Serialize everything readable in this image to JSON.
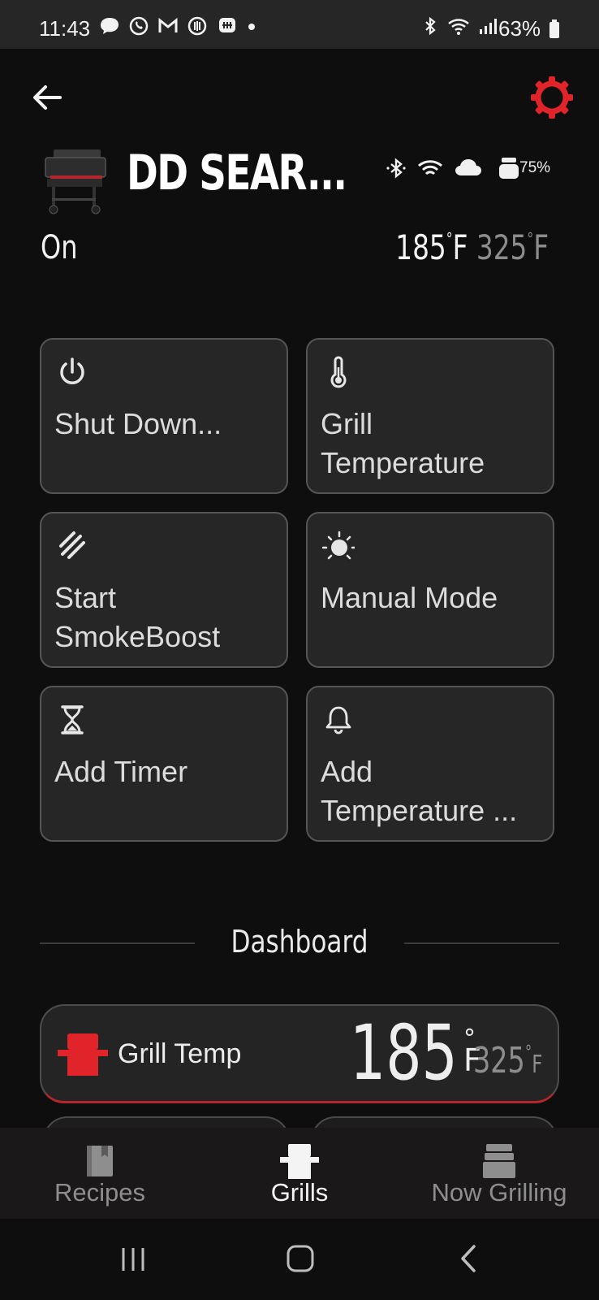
{
  "status_bar": {
    "time": "11:43",
    "left_icons": [
      "messages-icon",
      "whatsapp-icon",
      "gmail-icon",
      "threads-icon",
      "app-icon",
      "dot-icon"
    ],
    "right_icons": [
      "bluetooth-icon",
      "wifi-icon",
      "signal-icon"
    ],
    "battery": "63%"
  },
  "header": {
    "grill_name": "DD SEAR...",
    "pellet_level": "75%",
    "status": "On",
    "current_temp": "185",
    "target_temp": "325",
    "unit": "F",
    "degree": "°"
  },
  "actions": [
    {
      "label": "Shut Down...",
      "icon": "power-icon"
    },
    {
      "label": "Grill Temperature",
      "icon": "thermometer-icon"
    },
    {
      "label": "Start SmokeBoost",
      "icon": "smoke-icon"
    },
    {
      "label": "Manual Mode",
      "icon": "sun-icon"
    },
    {
      "label": "Add Timer",
      "icon": "hourglass-icon"
    },
    {
      "label": "Add Temperature ...",
      "icon": "bell-icon"
    }
  ],
  "dashboard": {
    "title": "Dashboard",
    "grill_temp": {
      "label": "Grill Temp",
      "current": "185",
      "unit": "F",
      "target": "325"
    }
  },
  "nav": {
    "items": [
      {
        "label": "Recipes",
        "active": false
      },
      {
        "label": "Grills",
        "active": true
      },
      {
        "label": "Now Grilling",
        "active": false
      }
    ]
  },
  "colors": {
    "accent_red": "#e0242a",
    "card_bg": "#262626",
    "inactive_nav": "#8e8e8e"
  }
}
